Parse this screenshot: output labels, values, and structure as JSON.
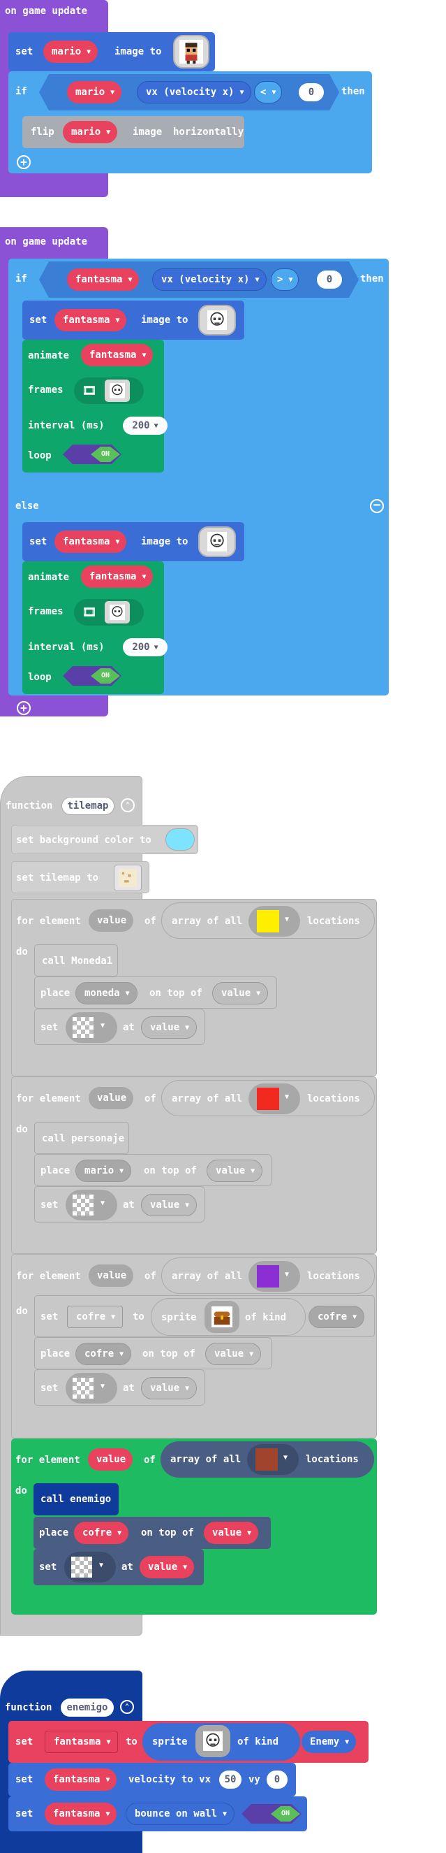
{
  "colors": {
    "purple": "#8c52d6",
    "blue": "#4ba8ef",
    "darkblue": "#3a6ed6",
    "red": "#e8425e",
    "green": "#0fa66b",
    "gray": "#c8c8c8",
    "gray_dark": "#a8a8a8",
    "navy": "#0f3b9c"
  },
  "block1": {
    "hat": "on game update",
    "set_kw": "set",
    "set_var": "mario",
    "image_to": "image to",
    "if_kw": "if",
    "if_var": "mario",
    "prop": "vx (velocity x)",
    "op": "<",
    "num": "0",
    "then": "then",
    "flip_kw": "flip",
    "flip_var": "mario",
    "flip_image": "image",
    "horizontally": "horizontally"
  },
  "block2": {
    "hat": "on game update",
    "if_kw": "if",
    "if_var": "fantasma",
    "prop": "vx (velocity x)",
    "op": ">",
    "num": "0",
    "then": "then",
    "set_kw": "set",
    "set_var": "fantasma",
    "image_to": "image to",
    "animate_kw": "animate",
    "animate_var": "fantasma",
    "frames_kw": "frames",
    "interval_kw": "interval (ms)",
    "interval": "200",
    "loop_kw": "loop",
    "loop_state": "ON",
    "else_kw": "else",
    "set2_var": "fantasma",
    "animate2_var": "fantasma",
    "interval2": "200",
    "loop2_state": "ON"
  },
  "block3": {
    "function_kw": "function",
    "function_name": "tilemap",
    "bg_text": "set background color to",
    "tilemap_text": "set tilemap to",
    "for_kw": "for element",
    "value": "value",
    "of": "of",
    "array_all": "array of all",
    "locations": "locations",
    "do_kw": "do",
    "call1": "call Moneda1",
    "place_kw": "place",
    "on_top_of": "on top of",
    "moneda": "moneda",
    "set_kw": "set",
    "at_kw": "at",
    "call2": "call personaje",
    "mario": "mario",
    "to_kw": "to",
    "sprite": "sprite",
    "of_kind": "of kind",
    "cofre": "cofre",
    "call4": "call enemigo"
  },
  "block4": {
    "function_kw": "function",
    "function_name": "enemigo",
    "set_kw": "set",
    "var": "fantasma",
    "to_kw": "to",
    "sprite": "sprite",
    "of_kind": "of kind",
    "kind": "Enemy",
    "velocity_to_vx": "velocity to vx",
    "vx": "50",
    "vy_kw": "vy",
    "vy": "0",
    "bounce": "bounce on wall",
    "bounce_state": "ON"
  }
}
